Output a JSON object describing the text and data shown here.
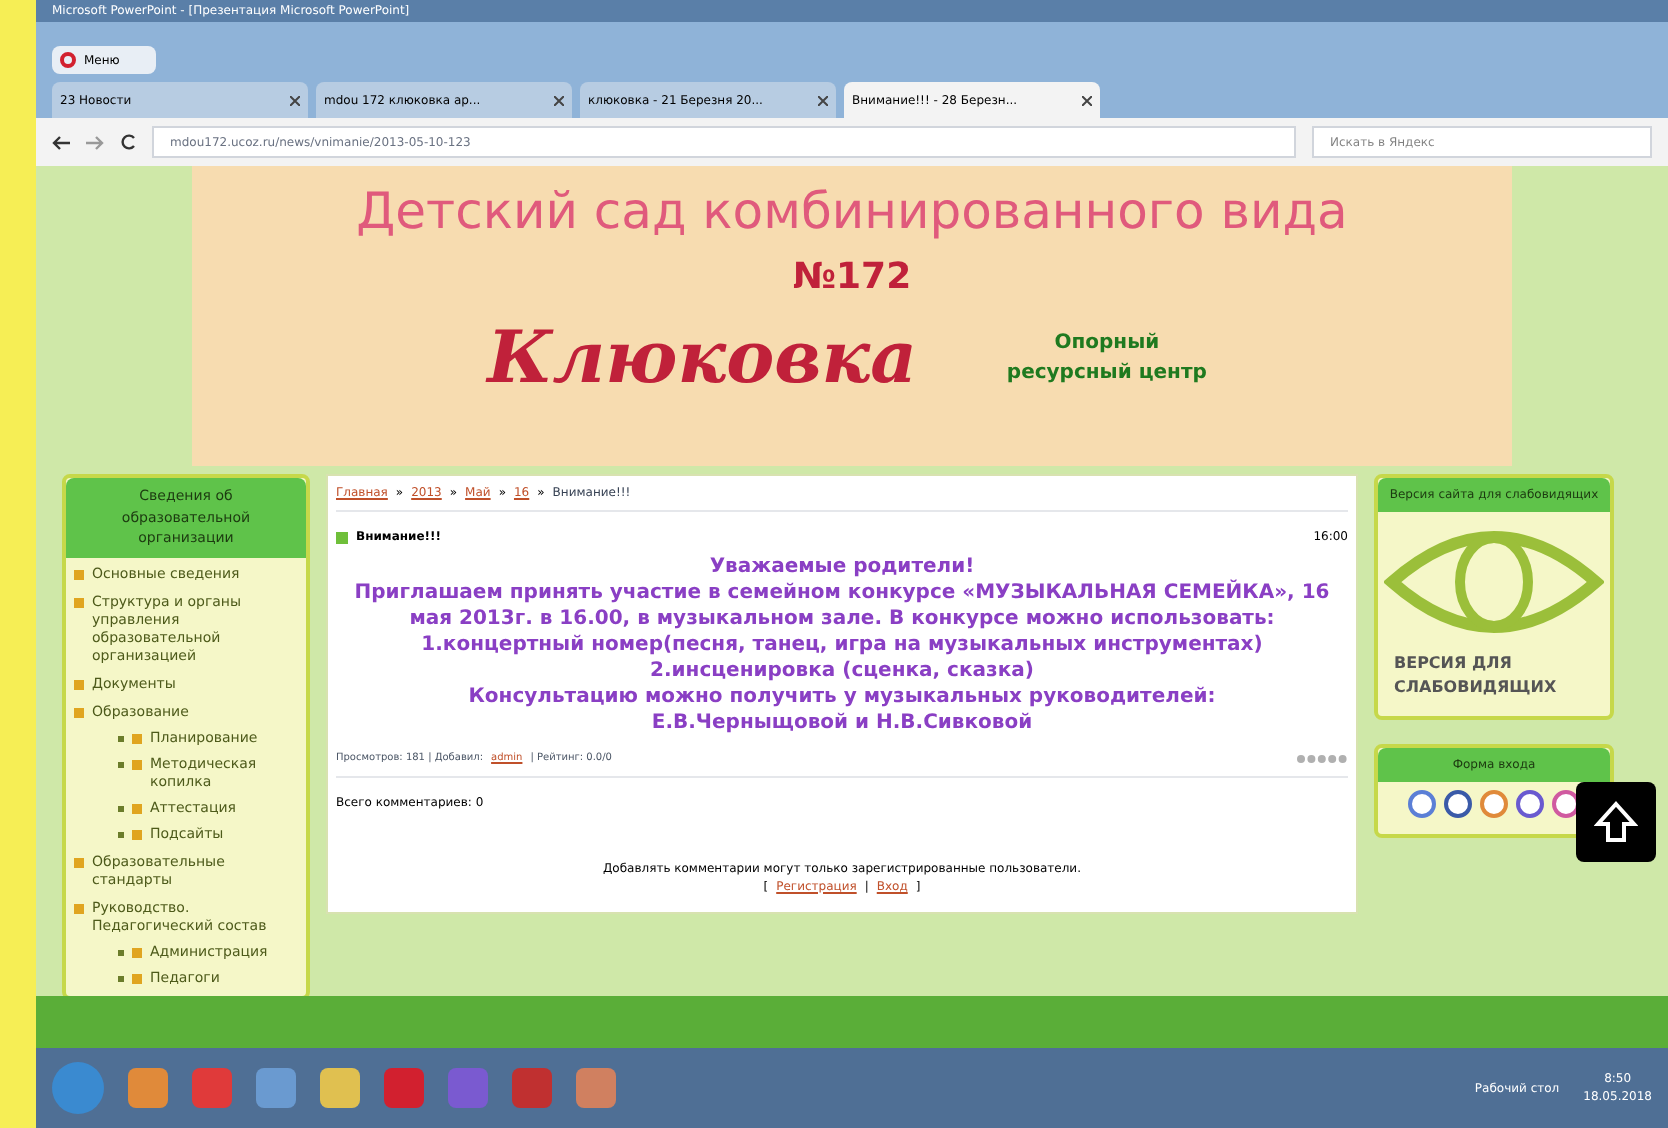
{
  "app_title": "Microsoft PowerPoint - [Презентация Microsoft PowerPoint]",
  "browser": {
    "menu": "Меню",
    "tabs": [
      {
        "label": "23 Новости",
        "selected": false
      },
      {
        "label": "mdou 172 клюковка ар...",
        "selected": false
      },
      {
        "label": "клюковка - 21 Березня 20...",
        "selected": false
      },
      {
        "label": "Внимание!!! - 28 Березн...",
        "selected": true
      }
    ],
    "address": "mdou172.ucoz.ru/news/vnimanie/2013-05-10-123",
    "search_placeholder": "Искать в Яндекс"
  },
  "header": {
    "title": "Детский сад комбинированного вида",
    "number": "№172",
    "name": "Клюковка",
    "badge": "Опорный ресурсный центр"
  },
  "left_menu": {
    "title": "Сведения об образовательной организации",
    "items": [
      {
        "label": "Основные сведения"
      },
      {
        "label": "Структура и органы управления образовательной организацией"
      },
      {
        "label": "Документы"
      },
      {
        "label": "Образование",
        "children": [
          {
            "label": "Планирование"
          },
          {
            "label": "Методическая копилка"
          },
          {
            "label": "Аттестация"
          },
          {
            "label": "Подсайты"
          }
        ]
      },
      {
        "label": "Образовательные стандарты"
      },
      {
        "label": "Руководство. Педагогический состав",
        "children": [
          {
            "label": "Администрация"
          },
          {
            "label": "Педагоги"
          }
        ]
      }
    ]
  },
  "breadcrumb_separator": "»",
  "breadcrumb": [
    {
      "label": "Главная",
      "link": true
    },
    {
      "label": "2013",
      "link": true
    },
    {
      "label": "Май",
      "link": true
    },
    {
      "label": "16",
      "link": true
    },
    {
      "label": "Внимание!!!",
      "link": false
    }
  ],
  "post": {
    "title": "Внимание!!!",
    "time": "16:00",
    "lines": [
      "Уважаемые родители!",
      "Приглашаем принять участие в семейном конкурсе «МУЗЫКАЛЬНАЯ СЕМЕЙКА», 16 мая 2013г. в 16.00, в музыкальном зале. В конкурсе можно использовать:",
      "1.концертный номер(песня, танец, игра на музыкальных инструментах)",
      "2.инсценировка (сценка, сказка)",
      "Консультацию можно получить у музыкальных руководителей:",
      "Е.В.Черныщовой и Н.В.Сивковой"
    ],
    "views": "Просмотров: 181 | Добавил:",
    "author": "admin",
    "rating": "| Рейтинг: 0.0/0"
  },
  "comments": {
    "count": "Всего комментариев: 0",
    "note": "Добавлять комментарии могут только зарегистрированные пользователи.",
    "register": "Регистрация",
    "login": "Вход",
    "open": "[",
    "sep": "|",
    "close": "]"
  },
  "right": {
    "panel_title": "Версия сайта для слабовидящих",
    "label": "ВЕРСИЯ ДЛЯ СЛАБОВИДЯЩИХ",
    "login_title": "Форма входа"
  },
  "taskbar": {
    "desktop": "Рабочий стол",
    "time": "8:50",
    "date": "18.05.2018"
  }
}
